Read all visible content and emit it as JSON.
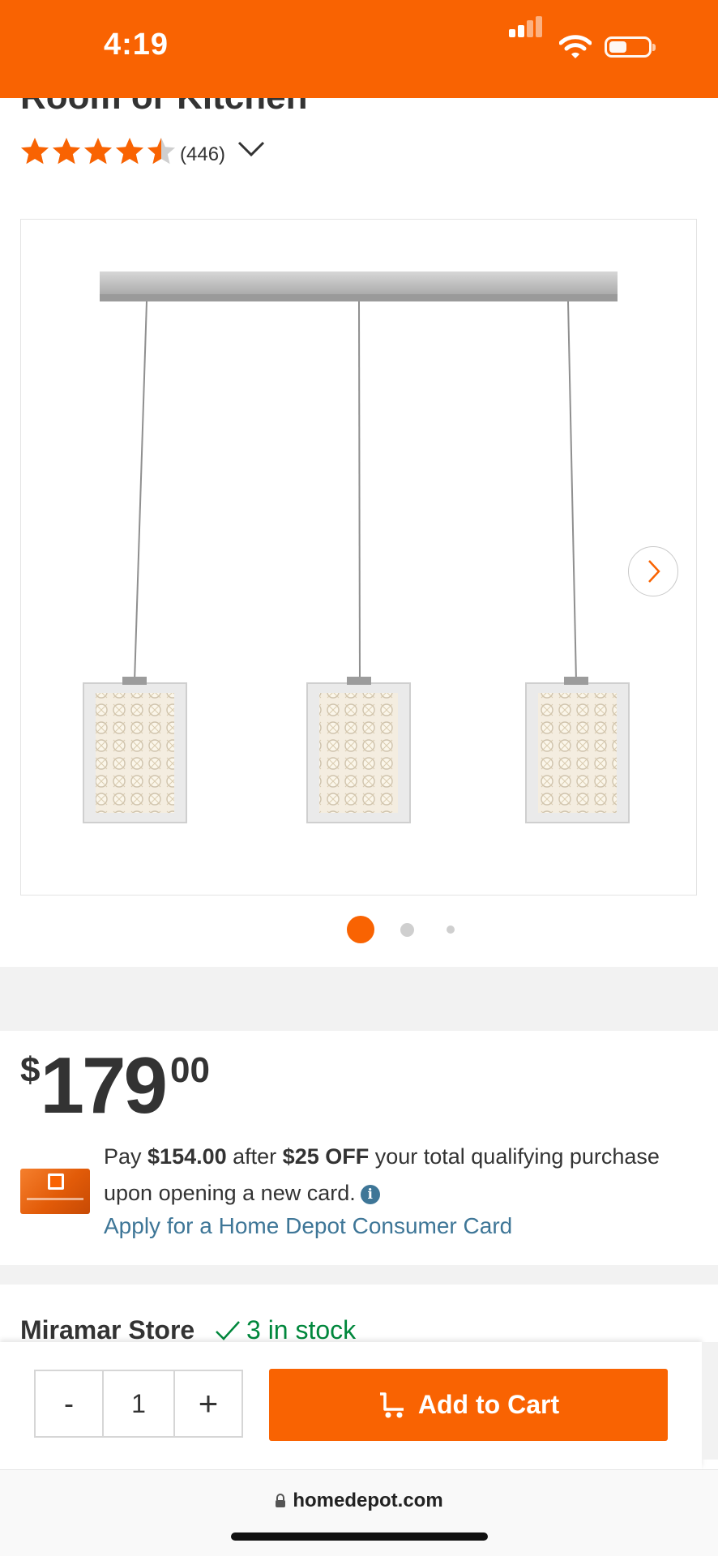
{
  "status_bar": {
    "time": "4:19",
    "background": "#f96302"
  },
  "product": {
    "title_fragment": "Room or Kitchen",
    "rating": 4.5,
    "rating_max": 5,
    "review_count": "(446)",
    "accent": "#f96302"
  },
  "gallery": {
    "slide_count": 3,
    "active_slide": 1
  },
  "price": {
    "currency": "$",
    "dollars": "179",
    "cents": "00"
  },
  "card_offer": {
    "pay_prefix": "Pay ",
    "pay_amount": "$154.00",
    "after_text": " after ",
    "discount": "$25 OFF",
    "suffix": " your total qualifying purchase upon opening a new card.",
    "info_glyph": "i",
    "apply_link": "Apply for a Home Depot Consumer Card",
    "link_color": "#3e7697"
  },
  "store": {
    "name": "Miramar Store",
    "stock": "3 in stock",
    "stock_color": "#00873c"
  },
  "cart_bar": {
    "minus_label": "-",
    "quantity": "1",
    "plus_label": "+",
    "add_label": "Add to Cart"
  },
  "browser": {
    "url": "homedepot.com"
  },
  "icons": {
    "star": "star-icon",
    "chevron_down": "chevron-down-icon",
    "chevron_right": "chevron-right-icon",
    "info": "info-icon",
    "check": "check-icon",
    "cart": "cart-icon",
    "lock": "lock-icon"
  }
}
